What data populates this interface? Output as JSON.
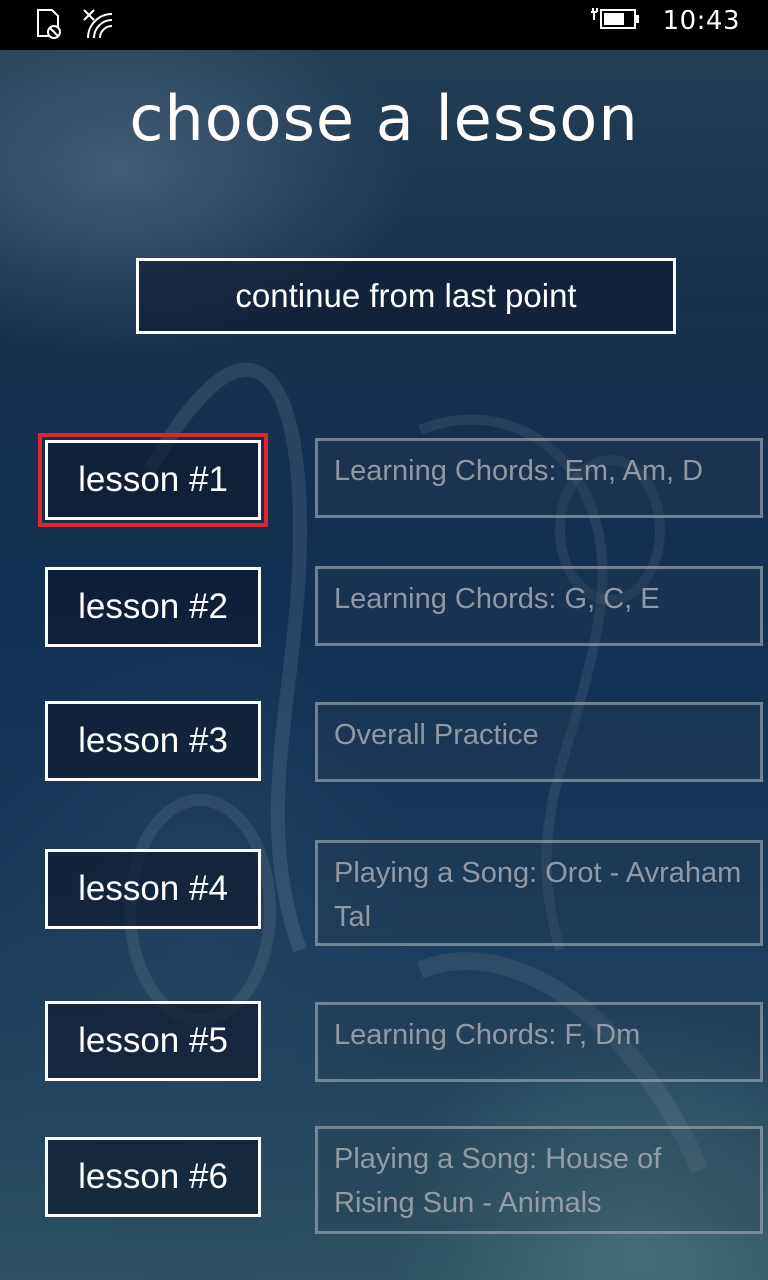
{
  "status_bar": {
    "time": "10:43",
    "icons": [
      "sim-blocked-icon",
      "wifi-no-internet-icon",
      "battery-charging-icon"
    ]
  },
  "page": {
    "title": "choose a lesson",
    "continue_label": "continue from last point"
  },
  "lessons": [
    {
      "label": "lesson #1",
      "description": "Learning Chords: Em, Am, D"
    },
    {
      "label": "lesson #2",
      "description": "Learning Chords: G, C, E"
    },
    {
      "label": "lesson #3",
      "description": "Overall Practice"
    },
    {
      "label": "lesson #4",
      "description": "Playing a Song: Orot - Avraham Tal"
    },
    {
      "label": "lesson #5",
      "description": "Learning Chords: F, Dm"
    },
    {
      "label": "lesson #6",
      "description": "Playing a Song: House of Rising Sun - Animals"
    }
  ],
  "colors": {
    "focus_border": "#e0262b",
    "button_border": "#ffffff",
    "description_text": "#a5aab2",
    "status_bar_bg": "#000000"
  }
}
